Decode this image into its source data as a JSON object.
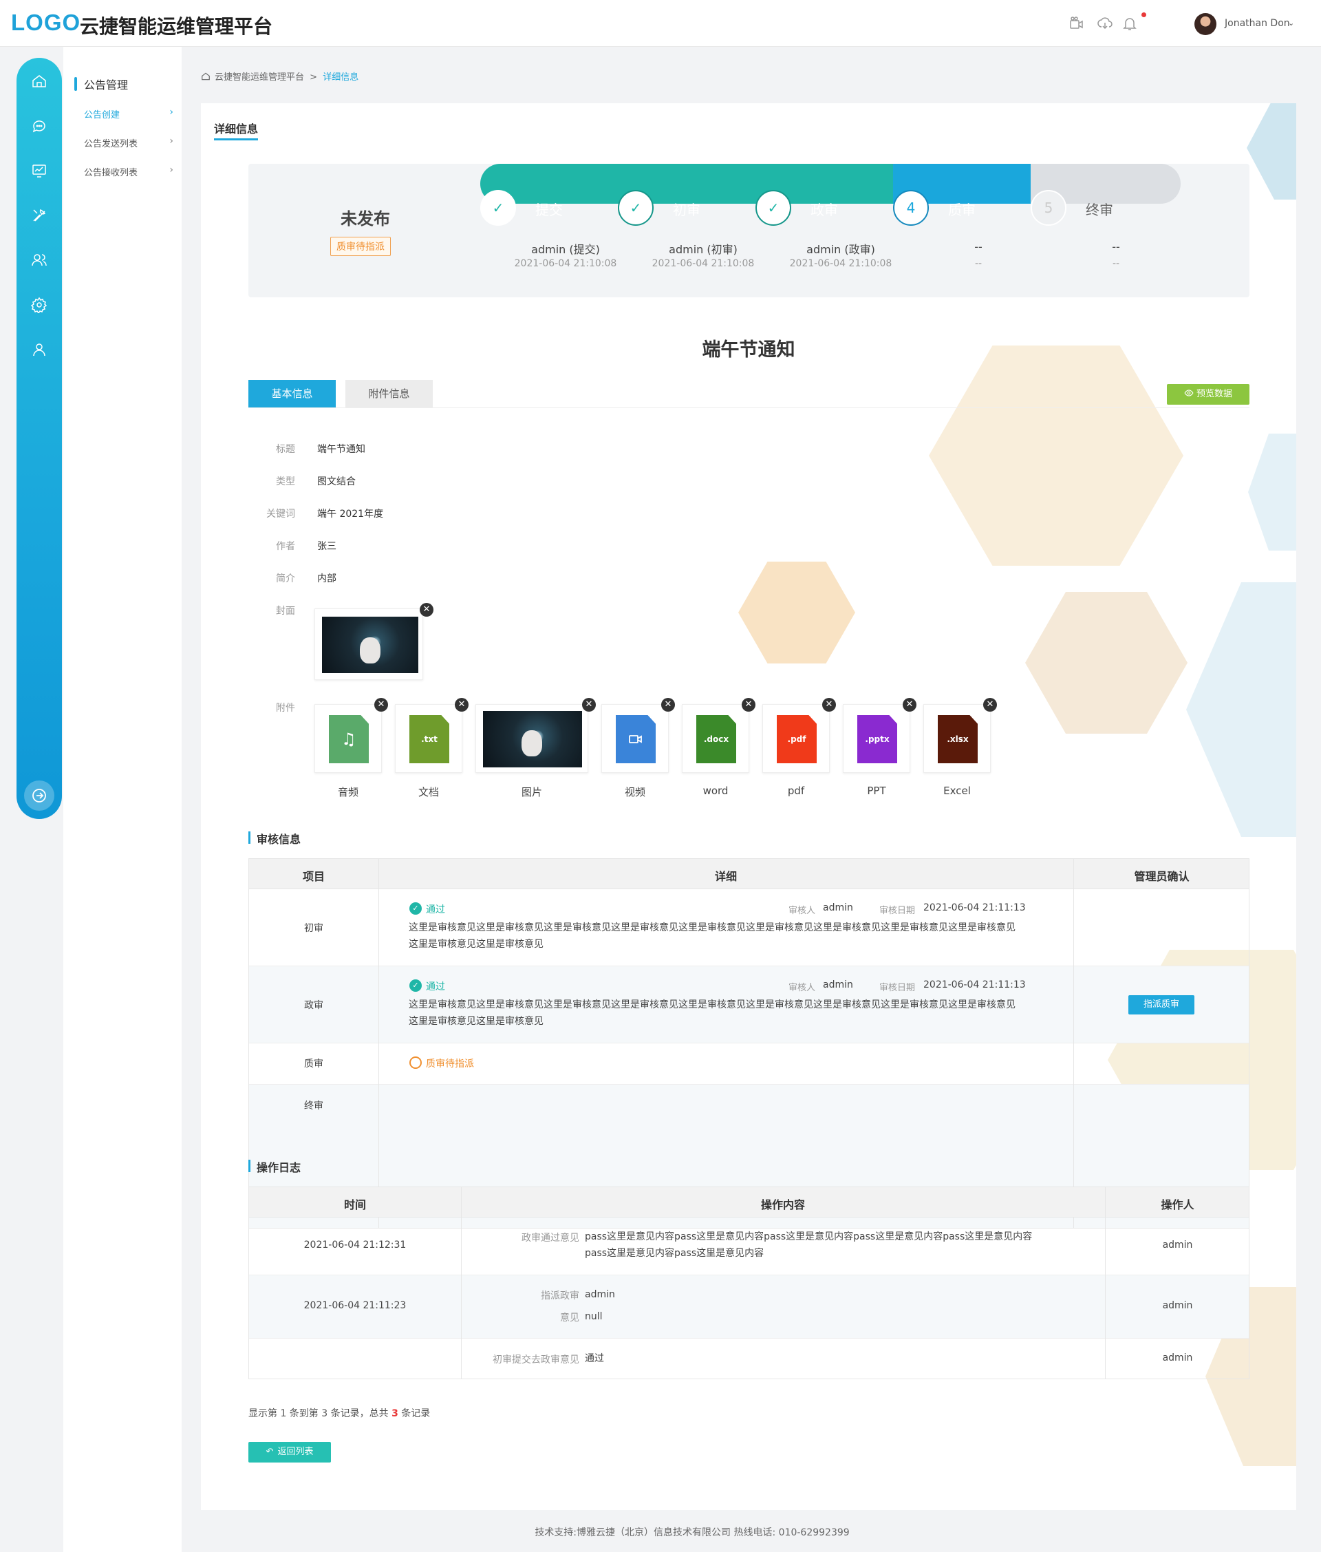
{
  "header": {
    "logo": "LOGO",
    "title": "云捷智能运维管理平台",
    "user_name": "Jonathan Don",
    "icons": [
      "video-camera-icon",
      "cloud-download-icon",
      "bell-icon"
    ]
  },
  "rail": {
    "items": [
      "home-icon",
      "chat-icon",
      "monitor-icon",
      "tools-icon",
      "users-icon",
      "settings-icon",
      "user-icon"
    ],
    "exit": "logout-icon"
  },
  "submenu": {
    "heading": "公告管理",
    "items": [
      {
        "label": "公告创建",
        "active": true
      },
      {
        "label": "公告发送列表",
        "active": false
      },
      {
        "label": "公告接收列表",
        "active": false
      }
    ]
  },
  "breadcrumb": {
    "root": "云捷智能运维管理平台",
    "separator": ">",
    "current": "详细信息"
  },
  "card_tab": "详细信息",
  "status": {
    "title": "未发布",
    "badge": "质审待指派",
    "steps": [
      {
        "label": "提交",
        "marker": "✓",
        "who": "admin (提交)",
        "when": "2021-06-04 21:10:08"
      },
      {
        "label": "初审",
        "marker": "✓",
        "who": "admin (初审)",
        "when": "2021-06-04 21:10:08"
      },
      {
        "label": "政审",
        "marker": "✓",
        "who": "admin (政审)",
        "when": "2021-06-04 21:10:08"
      },
      {
        "label": "质审",
        "marker": "4",
        "who": "--",
        "when": "--"
      },
      {
        "label": "终审",
        "marker": "5",
        "who": "--",
        "when": "--"
      }
    ]
  },
  "notice_title": "端午节通知",
  "tabs": {
    "basic": "基本信息",
    "attachments": "附件信息",
    "preview": "预览数据"
  },
  "fields": [
    {
      "label": "标题",
      "value": "端午节通知"
    },
    {
      "label": "类型",
      "value": "图文结合"
    },
    {
      "label": "关键词",
      "value": "端午 2021年度"
    },
    {
      "label": "作者",
      "value": "张三"
    },
    {
      "label": "简介",
      "value": "内部"
    },
    {
      "label": "封面",
      "value": ""
    },
    {
      "label": "附件",
      "value": ""
    }
  ],
  "attachments": [
    {
      "label": "音频",
      "ext": "",
      "color": "#5aaa6a",
      "kind": "audio"
    },
    {
      "label": "文档",
      "ext": ".txt",
      "color": "#6f9c2c",
      "kind": "file"
    },
    {
      "label": "图片",
      "ext": "",
      "color": "",
      "kind": "image"
    },
    {
      "label": "视频",
      "ext": "",
      "color": "#3a84d9",
      "kind": "video"
    },
    {
      "label": "word",
      "ext": ".docx",
      "color": "#3b8a2a",
      "kind": "file"
    },
    {
      "label": "pdf",
      "ext": ".pdf",
      "color": "#f03a1a",
      "kind": "file"
    },
    {
      "label": "PPT",
      "ext": ".pptx",
      "color": "#8a2ad0",
      "kind": "file"
    },
    {
      "label": "Excel",
      "ext": ".xlsx",
      "color": "#5a1a0a",
      "kind": "file"
    }
  ],
  "audit": {
    "title": "审核信息",
    "headers": [
      "项目",
      "详细",
      "管理员确认"
    ],
    "reviewer_key": "审核人",
    "date_key": "审核日期",
    "rows": [
      {
        "item": "初审",
        "status": "通过",
        "reviewer": "admin",
        "date": "2021-06-04 21:11:13",
        "opinion": "这里是审核意见这里是审核意见这里是审核意见这里是审核意见这里是审核意见这里是审核意见这里是审核意见这里是审核意见这里是审核意见这里是审核意见这里是审核意见"
      },
      {
        "item": "政审",
        "status": "通过",
        "reviewer": "admin",
        "date": "2021-06-04 21:11:13",
        "opinion": "这里是审核意见这里是审核意见这里是审核意见这里是审核意见这里是审核意见这里是审核意见这里是审核意见这里是审核意见这里是审核意见这里是审核意见这里是审核意见",
        "action": "指派质审"
      },
      {
        "item": "质审",
        "pending": "质审待指派"
      },
      {
        "item": "终审"
      }
    ]
  },
  "log": {
    "title": "操作日志",
    "headers": [
      "时间",
      "操作内容",
      "操作人"
    ],
    "rows": [
      {
        "time": "2021-06-04 21:12:31",
        "k1": "政审通过意见",
        "v1": "pass这里是意见内容pass这里是意见内容pass这里是意见内容pass这里是意见内容pass这里是意见内容pass这里是意见内容pass这里是意见内容",
        "who": "admin"
      },
      {
        "time": "2021-06-04 21:11:23",
        "k1": "指派政审",
        "v1": "admin",
        "k2": "意见",
        "v2": "null",
        "who": "admin"
      },
      {
        "time": "",
        "k1": "初审提交去政审意见",
        "v1": "通过",
        "who": "admin"
      }
    ]
  },
  "pager": {
    "prefix": "显示第 1 条到第 3 条记录，总共",
    "total": "3",
    "suffix": "条记录"
  },
  "back_button": "返回列表",
  "footer": "技术支持:博雅云捷（北京）信息技术有限公司  热线电话: 010-62992399"
}
